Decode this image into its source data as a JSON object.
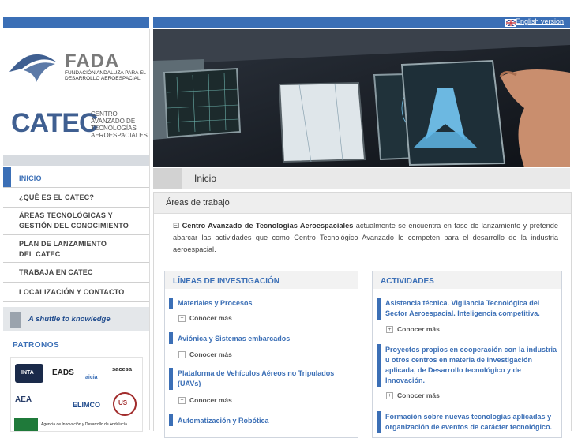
{
  "header": {
    "language_link": "English version"
  },
  "logos": {
    "fada_name": "FADA",
    "fada_subtitle": "FUNDACIÓN ANDALUZA PARA EL DESARROLLO AEROESPACIAL",
    "catec_name": "CATEC",
    "catec_subtitle": "CENTRO AVANZADO DE TECNOLOGÍAS AEROESPACIALES"
  },
  "nav": {
    "items": [
      {
        "label": "INICIO"
      },
      {
        "label": "¿QUÉ ES EL CATEC?"
      },
      {
        "label": "ÁREAS TECNOLÓGICAS Y GESTIÓN DEL CONOCIMIENTO"
      },
      {
        "label": "PLAN DE LANZAMIENTO DEL CATEC"
      },
      {
        "label": "TRABAJA EN CATEC"
      },
      {
        "label": "LOCALIZACIÓN Y CONTACTO"
      }
    ]
  },
  "shuttle": {
    "label": "A shuttle to knowledge"
  },
  "patronos": {
    "title": "PATRONOS",
    "logos": [
      "INTA",
      "EADS",
      "aicia",
      "sacesa",
      "AEA",
      "ELIMCO",
      "US",
      "Agencia de Innovación y Desarrollo de Andalucía"
    ]
  },
  "breadcrumb": {
    "label": "Inicio"
  },
  "main": {
    "section_title": "Áreas de trabajo",
    "intro_prefix": "El ",
    "intro_bold": "Centro Avanzado de Tecnologías Aeroespaciales",
    "intro_rest": " actualmente se encuentra en fase de lanzamiento y pretende abarcar las actividades que como Centro Tecnológico Avanzado le competen para el desarrollo de la industria aeroespacial."
  },
  "lineas": {
    "title": "LÍNEAS DE INVESTIGACIÓN",
    "items": [
      {
        "label": "Materiales y Procesos",
        "more": "Conocer más"
      },
      {
        "label": "Aviónica y Sistemas embarcados",
        "more": "Conocer más"
      },
      {
        "label": "Plataforma de Vehículos Aéreos no Tripulados (UAVs)",
        "more": "Conocer más"
      },
      {
        "label": "Automatización y Robótica"
      }
    ]
  },
  "actividades": {
    "title": "ACTIVIDADES",
    "items": [
      {
        "label": "Asistencia técnica. Vigilancia Tecnológica del Sector Aeroespacial. Inteligencia competitiva.",
        "more": "Conocer más"
      },
      {
        "label": "Proyectos propios en cooperación con la industria u otros centros en materia de Investigación aplicada, de Desarrollo tecnológico y de Innovación.",
        "more": "Conocer más"
      },
      {
        "label": "Formación sobre nuevas tecnologías aplicadas y organización de eventos de carácter tecnológico."
      }
    ]
  },
  "colors": {
    "accent": "#3b6fb6",
    "nav_text": "#444444",
    "panel_grey": "#e9e9e9"
  }
}
